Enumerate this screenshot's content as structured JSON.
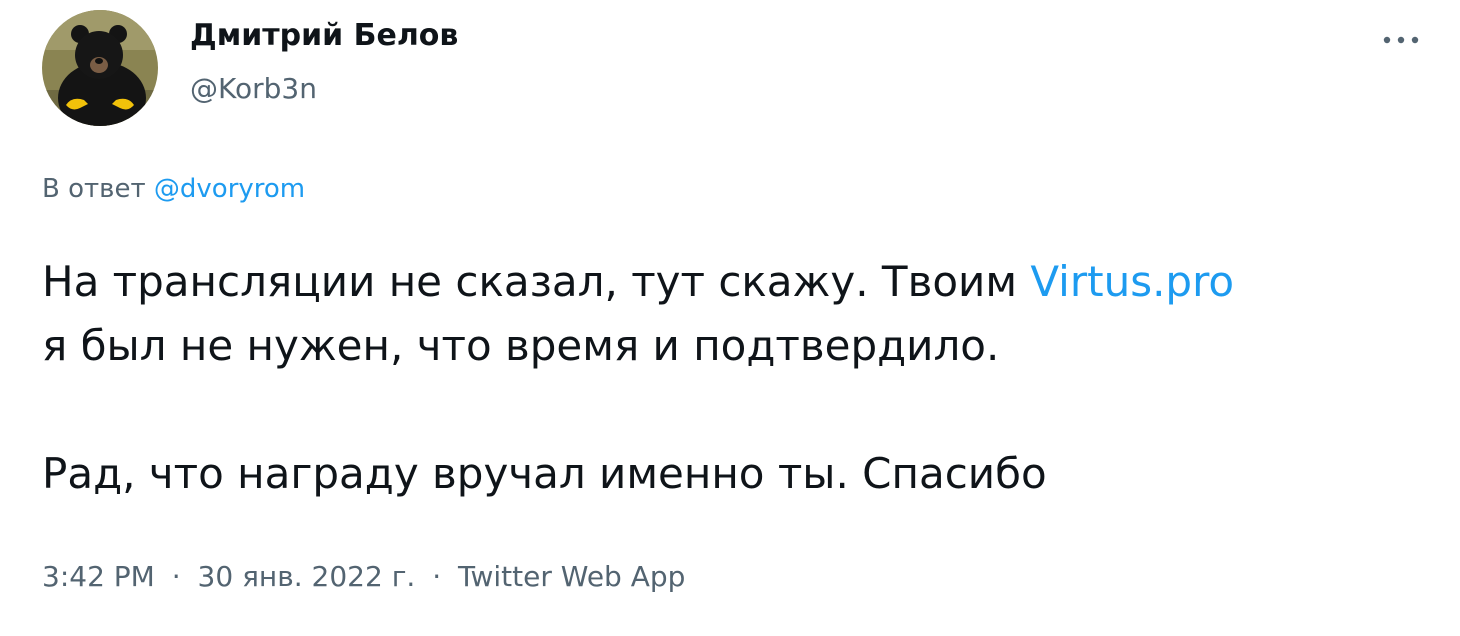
{
  "author": {
    "name": "Дмитрий Белов",
    "handle": "@Korb3n",
    "avatar_icon": "bear-avatar-icon"
  },
  "menu": {
    "icon": "more-options-icon",
    "label": "···"
  },
  "reply": {
    "prefix": "В ответ",
    "mention": "@dvoryrom"
  },
  "body": {
    "line1_text": "На трансляции не сказал, тут скажу. Твоим ",
    "line1_link": "Virtus.pro",
    "line2_text": "я был не нужен, что время и подтвердило.",
    "paragraph2": "Рад, что награду вручал именно ты. Спасибо"
  },
  "meta": {
    "time": "3:42 PM",
    "separator": "·",
    "date": "30 янв. 2022 г.",
    "source": "Twitter Web App"
  },
  "colors": {
    "text": "#0f1419",
    "secondary": "#536471",
    "accent": "#1d9bf0"
  }
}
